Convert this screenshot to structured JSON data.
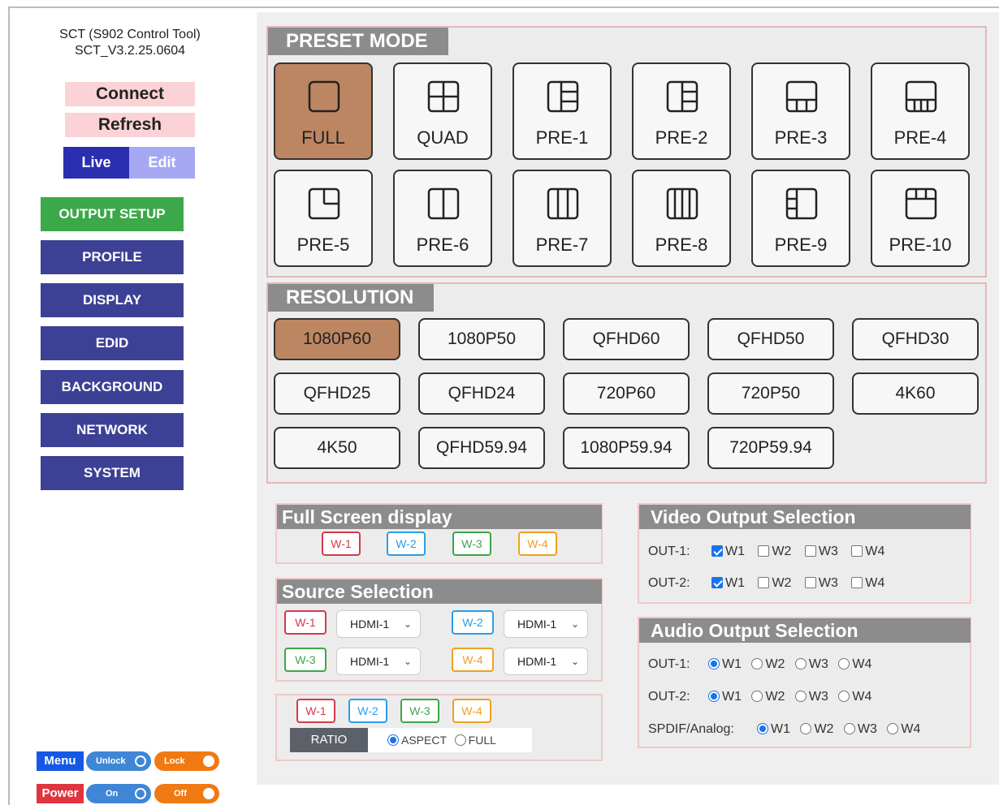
{
  "app": {
    "title_line1": "SCT (S902 Control Tool)",
    "title_line2": "SCT_V3.2.25.0604"
  },
  "sidebar": {
    "connect": "Connect",
    "refresh": "Refresh",
    "live": "Live",
    "edit": "Edit",
    "nav": [
      "OUTPUT SETUP",
      "PROFILE",
      "DISPLAY",
      "EDID",
      "BACKGROUND",
      "NETWORK",
      "SYSTEM"
    ],
    "active_nav": "OUTPUT SETUP"
  },
  "footer": {
    "menu": "Menu",
    "unlock": "Unlock",
    "lock": "Lock",
    "power": "Power",
    "on": "On",
    "off": "Off"
  },
  "preset": {
    "title": "PRESET MODE",
    "items": [
      "FULL",
      "QUAD",
      "PRE-1",
      "PRE-2",
      "PRE-3",
      "PRE-4",
      "PRE-5",
      "PRE-6",
      "PRE-7",
      "PRE-8",
      "PRE-9",
      "PRE-10"
    ],
    "selected": "FULL"
  },
  "resolution": {
    "title": "RESOLUTION",
    "items": [
      "1080P60",
      "1080P50",
      "QFHD60",
      "QFHD50",
      "QFHD30",
      "QFHD25",
      "QFHD24",
      "720P60",
      "720P50",
      "4K60",
      "4K50",
      "QFHD59.94",
      "1080P59.94",
      "720P59.94"
    ],
    "selected": "1080P60"
  },
  "windows": [
    "W-1",
    "W-2",
    "W-3",
    "W-4"
  ],
  "full_screen": {
    "title": "Full Screen display"
  },
  "source": {
    "title": "Source Selection",
    "values": [
      "HDMI-1",
      "HDMI-1",
      "HDMI-1",
      "HDMI-1"
    ]
  },
  "ratio": {
    "label": "RATIO",
    "aspect": "ASPECT",
    "full": "FULL",
    "selected": "ASPECT"
  },
  "video_output": {
    "title": "Video Output Selection",
    "rows": [
      {
        "label": "OUT-1:",
        "opts": [
          "W1",
          "W2",
          "W3",
          "W4"
        ],
        "checked": [
          "W1"
        ]
      },
      {
        "label": "OUT-2:",
        "opts": [
          "W1",
          "W2",
          "W3",
          "W4"
        ],
        "checked": [
          "W1"
        ]
      }
    ]
  },
  "audio_output": {
    "title": "Audio Output Selection",
    "rows": [
      {
        "label": "OUT-1:",
        "opts": [
          "W1",
          "W2",
          "W3",
          "W4"
        ],
        "selected": "W1"
      },
      {
        "label": "OUT-2:",
        "opts": [
          "W1",
          "W2",
          "W3",
          "W4"
        ],
        "selected": "W1"
      },
      {
        "label": "SPDIF/Analog:",
        "opts": [
          "W1",
          "W2",
          "W3",
          "W4"
        ],
        "selected": "W1"
      }
    ]
  }
}
